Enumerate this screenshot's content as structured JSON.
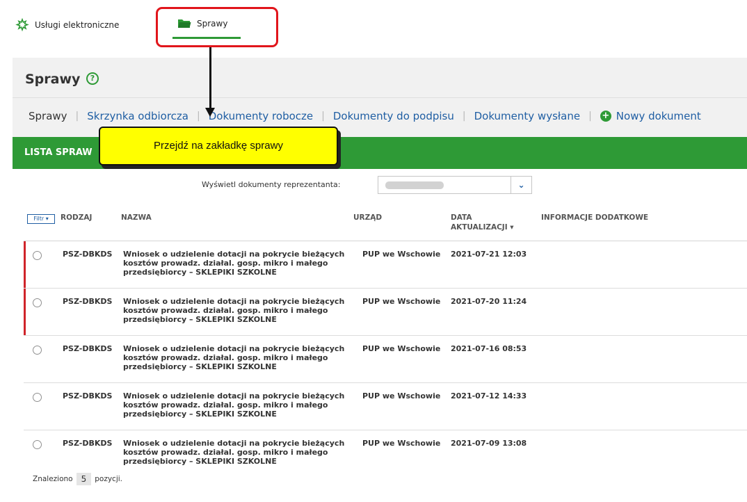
{
  "topnav": {
    "uslugi_label": "Usługi elektroniczne",
    "sprawy_label": "Sprawy"
  },
  "page": {
    "title": "Sprawy",
    "help_icon": "?"
  },
  "subtabs": [
    "Sprawy",
    "Skrzynka odbiorcza",
    "Dokumenty robocze",
    "Dokumenty do podpisu",
    "Dokumenty wysłane",
    "Nowy dokument"
  ],
  "list": {
    "title": "LISTA SPRAW"
  },
  "callout": {
    "text": "Przejdź na zakładkę sprawy"
  },
  "representative": {
    "label": "Wyświetl dokumenty reprezentanta:",
    "value": ""
  },
  "table": {
    "filter_label": "Filtr ▾",
    "headers": {
      "kind": "RODZAJ",
      "name": "NAZWA",
      "office": "URZĄD",
      "date": "DATA AKTUALIZACJI ▾",
      "info": "INFORMACJE DODATKOWE"
    },
    "rows": [
      {
        "kind": "PSZ-DBKDS",
        "name": "Wniosek o udzielenie dotacji na pokrycie bieżących kosztów prowadz. działal. gosp. mikro i małego przedsiębiorcy – SKLEPIKI SZKOLNE",
        "office": "PUP we Wschowie",
        "date": "2021-07-21 12:03",
        "unread": true
      },
      {
        "kind": "PSZ-DBKDS",
        "name": "Wniosek o udzielenie dotacji na pokrycie bieżących kosztów prowadz. działal. gosp. mikro i małego przedsiębiorcy – SKLEPIKI SZKOLNE",
        "office": "PUP we Wschowie",
        "date": "2021-07-20 11:24",
        "unread": true
      },
      {
        "kind": "PSZ-DBKDS",
        "name": "Wniosek o udzielenie dotacji na pokrycie bieżących kosztów prowadz. działal. gosp. mikro i małego przedsiębiorcy – SKLEPIKI SZKOLNE",
        "office": "PUP we Wschowie",
        "date": "2021-07-16 08:53",
        "unread": false
      },
      {
        "kind": "PSZ-DBKDS",
        "name": "Wniosek o udzielenie dotacji na pokrycie bieżących kosztów prowadz. działal. gosp. mikro i małego przedsiębiorcy – SKLEPIKI SZKOLNE",
        "office": "PUP we Wschowie",
        "date": "2021-07-12 14:33",
        "unread": false
      },
      {
        "kind": "PSZ-DBKDS",
        "name": "Wniosek o udzielenie dotacji na pokrycie bieżących kosztów prowadz. działal. gosp. mikro i małego przedsiębiorcy – SKLEPIKI SZKOLNE",
        "office": "PUP we Wschowie",
        "date": "2021-07-09 13:08",
        "unread": false
      }
    ]
  },
  "found": {
    "prefix": "Znaleziono",
    "count": "5",
    "suffix": "pozycji."
  },
  "colors": {
    "accent_green": "#2e9a36",
    "link_blue": "#1f5ea3",
    "unread_red": "#d0242a",
    "callout_yellow": "#ffff00",
    "highlight_red": "#e1151b"
  }
}
